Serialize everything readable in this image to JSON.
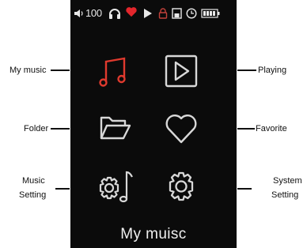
{
  "status_bar": {
    "volume_text": "100",
    "icons": [
      "speaker-icon",
      "headphones-icon",
      "heart-icon",
      "play-icon",
      "lock-icon",
      "save-icon",
      "clock-icon",
      "battery-icon"
    ]
  },
  "menu": {
    "items": [
      {
        "icon": "music-note-icon",
        "color": "#e03a2e"
      },
      {
        "icon": "play-box-icon",
        "color": "#d8d8d8"
      },
      {
        "icon": "folder-icon",
        "color": "#d8d8d8"
      },
      {
        "icon": "heart-outline-icon",
        "color": "#d8d8d8"
      },
      {
        "icon": "gear-note-icon",
        "color": "#d8d8d8"
      },
      {
        "icon": "gear-icon",
        "color": "#d8d8d8"
      }
    ],
    "title": "My muisc"
  },
  "callouts": {
    "my_music": "My music",
    "playing": "Playing",
    "folder": "Folder",
    "favorite": "Favorite",
    "music_setting_1": "Music",
    "music_setting_2": "Setting",
    "system_setting_1": "System",
    "system_setting_2": "Setting"
  },
  "colors": {
    "screen_bg": "#0b0b0b",
    "accent": "#e03a2e",
    "icon": "#d8d8d8"
  }
}
